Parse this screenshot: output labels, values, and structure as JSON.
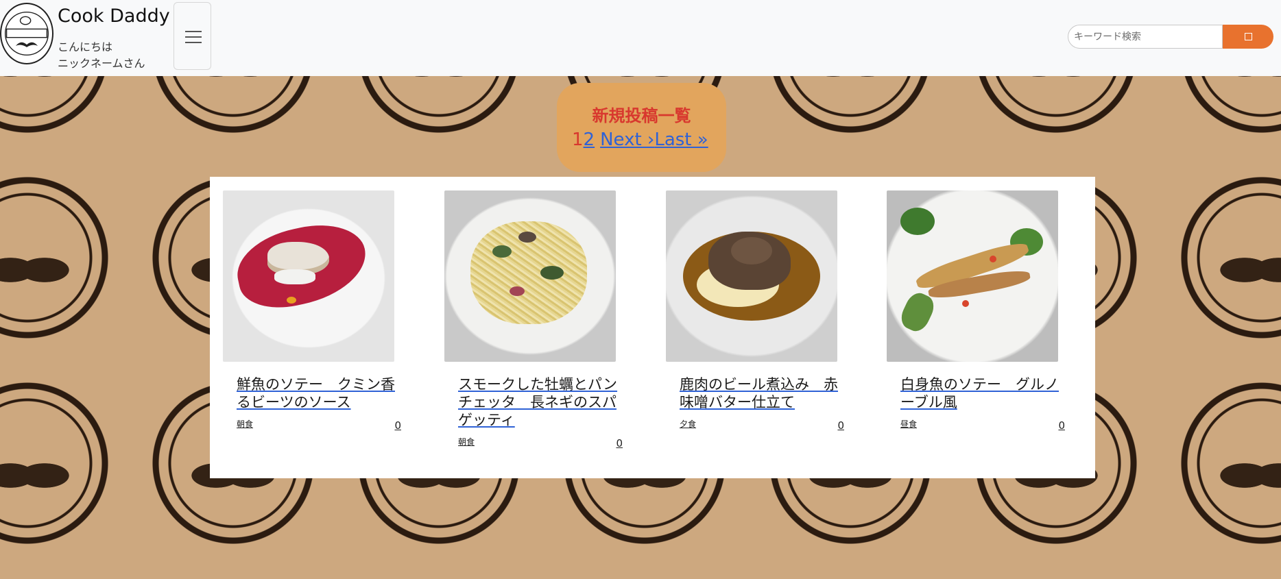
{
  "header": {
    "brand": "Cook Daddy",
    "greeting_line1": "こんにちは",
    "greeting_line2": "ニックネームさん",
    "search_placeholder": "キーワード検索",
    "accent_color": "#e8722e"
  },
  "badge": {
    "title": "新規投稿一覧",
    "pager": {
      "current": "1",
      "page2": "2",
      "next": "Next ›",
      "last": "Last »"
    }
  },
  "recipes": [
    {
      "title": "鮮魚のソテー　クミン香るビーツのソース",
      "tag": "朝食",
      "count": "0"
    },
    {
      "title": "スモークした牡蠣とパンチェッタ　長ネギのスパゲッティ",
      "tag": "朝食",
      "count": "0"
    },
    {
      "title": "鹿肉のビール煮込み　赤味噌バター仕立て",
      "tag": "夕食",
      "count": "0"
    },
    {
      "title": "白身魚のソテー　グルノーブル風",
      "tag": "昼食",
      "count": "0"
    }
  ]
}
